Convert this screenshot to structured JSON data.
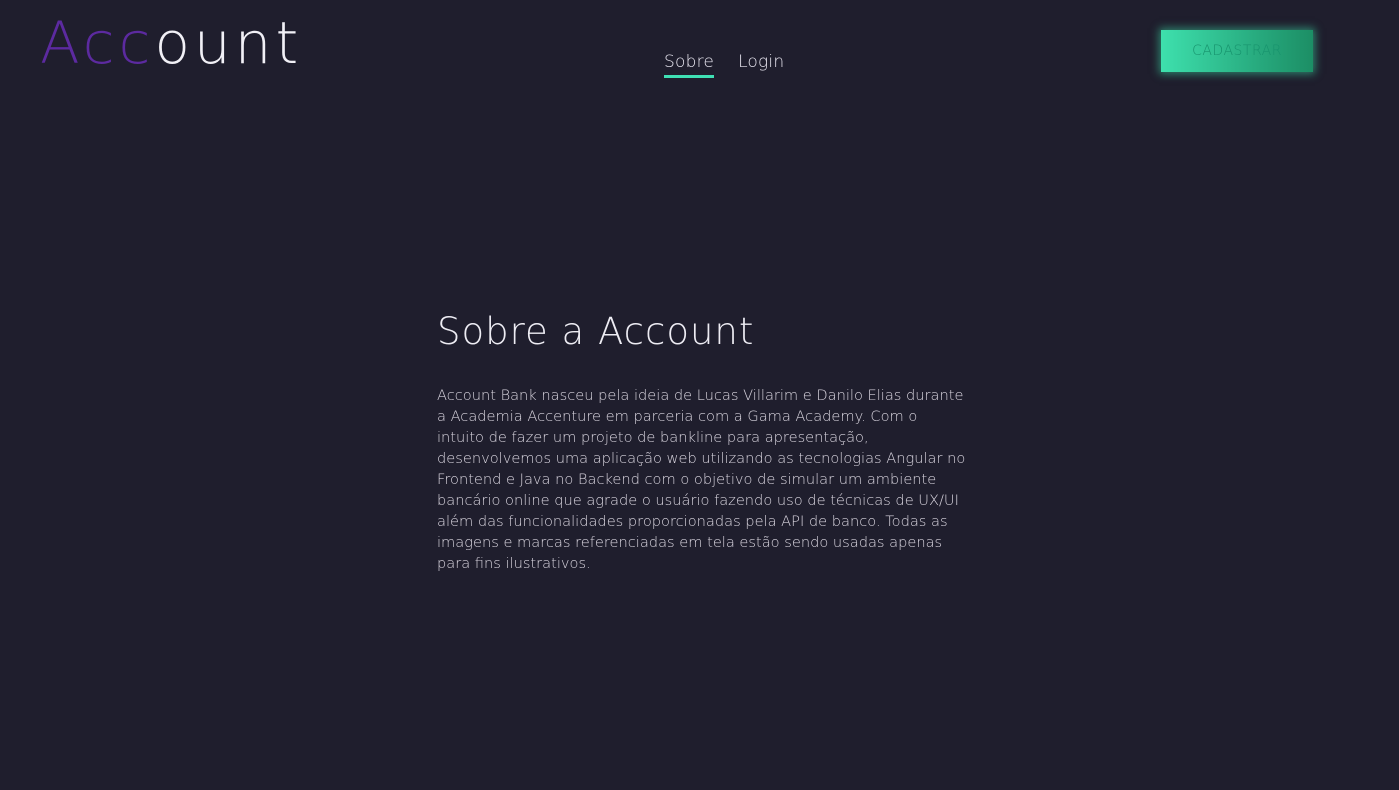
{
  "header": {
    "logo": {
      "accent_text": "Acc",
      "rest_text": "ount"
    },
    "nav": {
      "items": [
        {
          "label": "Sobre",
          "active": true
        },
        {
          "label": "Login",
          "active": false
        }
      ]
    },
    "signup_label": "CADASTRAR"
  },
  "about": {
    "title": "Sobre a Account",
    "text": "Account Bank nasceu pela ideia de Lucas Villarim e Danilo Elias durante a Academia Accenture em parceria com a Gama Academy. Com o intuito de fazer um projeto de bankline para apresentação, desenvolvemos uma aplicação web utilizando as tecnologias Angular no Frontend e Java no Backend com o objetivo de simular um ambiente bancário online que agrade o usuário fazendo uso de técnicas de UX/UI além das funcionalidades proporcionadas pela API de banco. Todas as imagens e marcas referenciadas em tela estão sendo usadas apenas para fins ilustrativos."
  },
  "colors": {
    "background": "#1f1e2d",
    "logo_accent": "#5c2aa0",
    "nav_underline": "#3fe0b4",
    "button_gradient_start": "#3ee0ad",
    "button_gradient_end": "#1c8e65"
  }
}
